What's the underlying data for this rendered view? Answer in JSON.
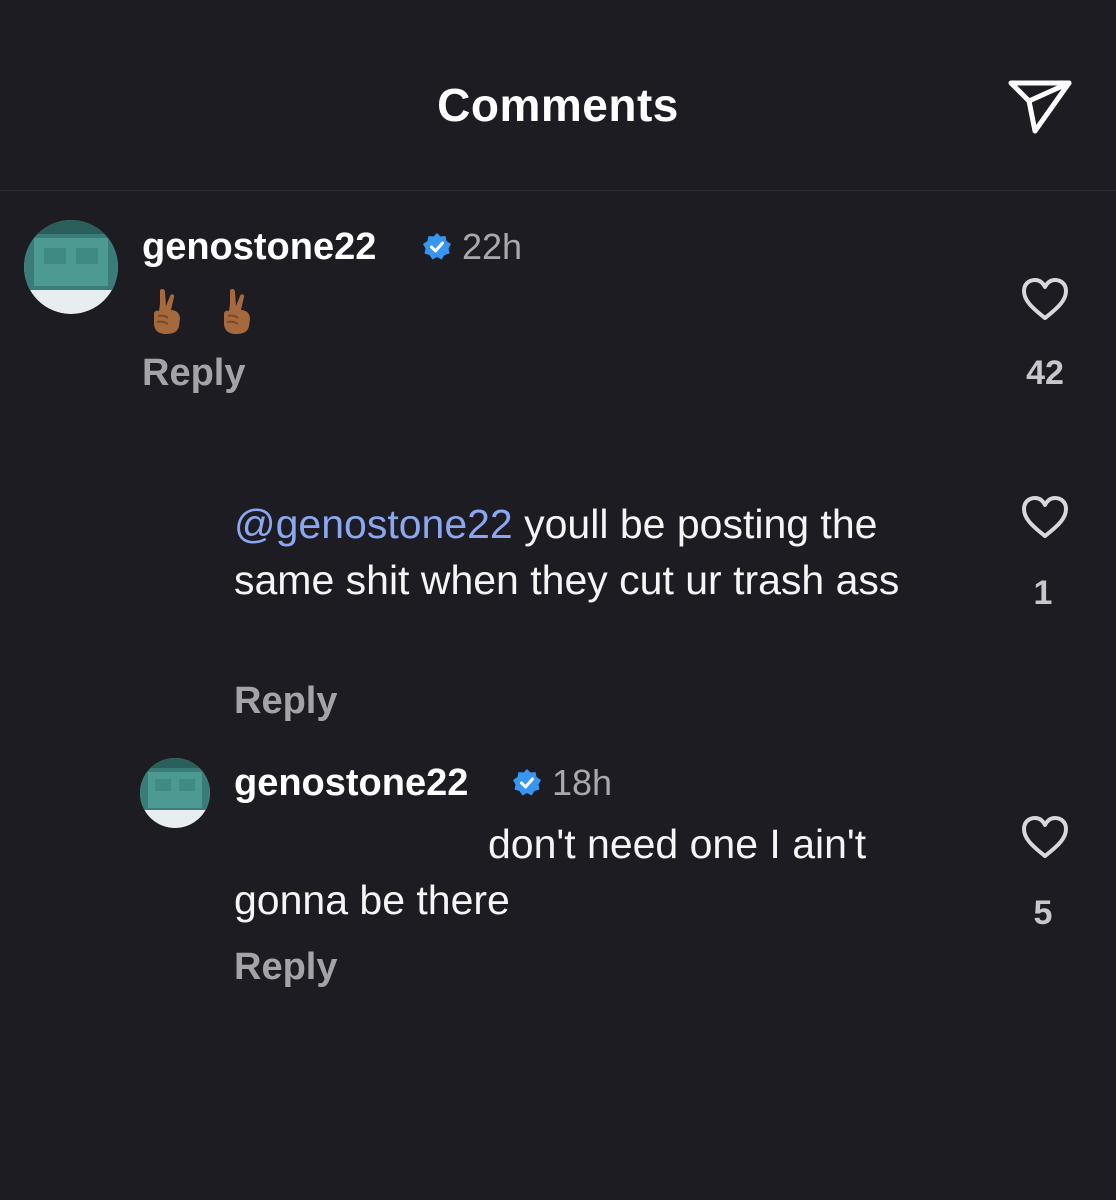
{
  "header": {
    "title": "Comments",
    "send_icon": "paper-plane-icon"
  },
  "comments": [
    {
      "username": "genostone22",
      "time": "22h",
      "text": "🤞🏾🤞🏾",
      "reply_label": "Reply",
      "likes": "42"
    },
    {
      "mention": "@genostone22",
      "text": " youll be posting the same shit when they cut ur trash ass",
      "reply_label": "Reply",
      "likes": "1"
    },
    {
      "username": "genostone22",
      "time": "18h",
      "text_line1": "don't need one I ain't",
      "text_line2": "gonna be there",
      "reply_label": "Reply",
      "likes": "5"
    }
  ],
  "colors": {
    "background": "#1c1c22",
    "mention": "#8aa7ef",
    "verified": "#3797f0",
    "muted": "#a3a3a8"
  }
}
